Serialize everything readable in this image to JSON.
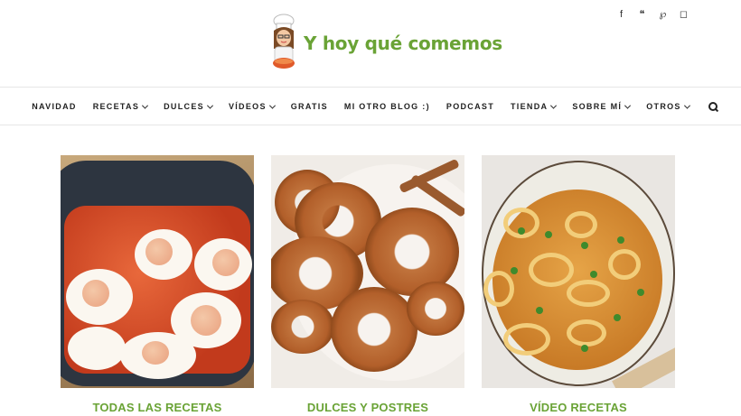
{
  "header": {
    "site_title": "Y hoy qué comemos",
    "social": [
      {
        "name": "facebook-icon",
        "glyph": "f"
      },
      {
        "name": "twitter-icon",
        "glyph": "❝"
      },
      {
        "name": "pinterest-icon",
        "glyph": "℘"
      },
      {
        "name": "instagram-icon",
        "glyph": "◻"
      }
    ]
  },
  "nav": {
    "items": [
      {
        "label": "NAVIDAD",
        "dropdown": false
      },
      {
        "label": "RECETAS",
        "dropdown": true
      },
      {
        "label": "DULCES",
        "dropdown": true
      },
      {
        "label": "VÍDEOS",
        "dropdown": true
      },
      {
        "label": "GRATIS",
        "dropdown": false
      },
      {
        "label": "MI OTRO BLOG :)",
        "dropdown": false
      },
      {
        "label": "PODCAST",
        "dropdown": false
      },
      {
        "label": "TIENDA",
        "dropdown": true
      },
      {
        "label": "SOBRE MÍ",
        "dropdown": true
      },
      {
        "label": "OTROS",
        "dropdown": true
      }
    ]
  },
  "cards": [
    {
      "title": "TODAS LAS RECETAS"
    },
    {
      "title": "DULCES Y POSTRES"
    },
    {
      "title": "VÍDEO RECETAS"
    }
  ],
  "colors": {
    "accent": "#6aa336"
  }
}
